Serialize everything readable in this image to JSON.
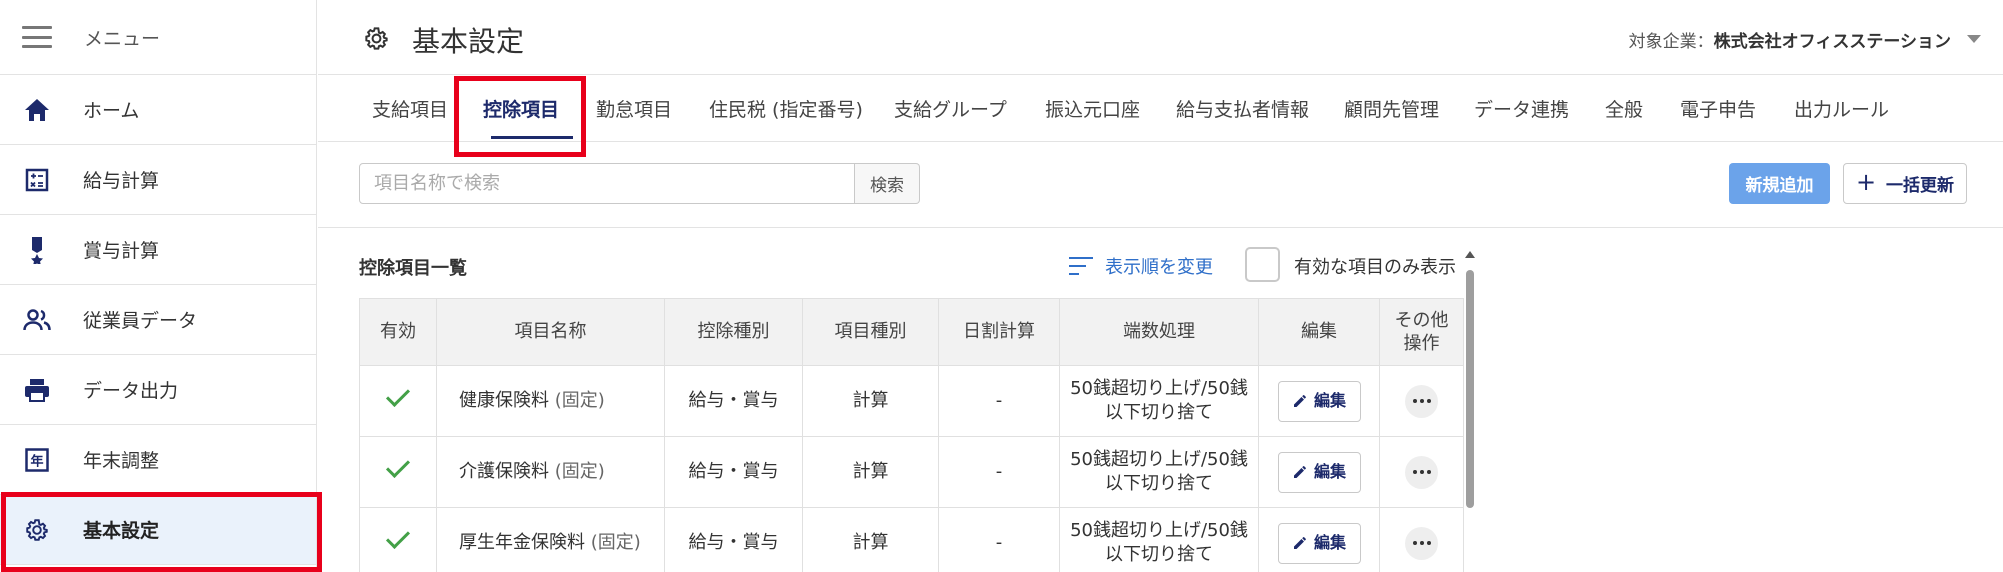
{
  "sidebar": {
    "menu_label": "メニュー",
    "items": [
      {
        "label": "ホーム",
        "icon": "home-icon"
      },
      {
        "label": "給与計算",
        "icon": "calculator-icon"
      },
      {
        "label": "賞与計算",
        "icon": "medal-icon"
      },
      {
        "label": "従業員データ",
        "icon": "people-icon"
      },
      {
        "label": "データ出力",
        "icon": "printer-icon"
      },
      {
        "label": "年末調整",
        "icon": "year-icon",
        "glyph": "年"
      },
      {
        "label": "基本設定",
        "icon": "gear-icon",
        "active": true
      }
    ]
  },
  "header": {
    "title": "基本設定",
    "company_prefix": "対象企業：",
    "company_name": "株式会社オフィスステーション"
  },
  "tabs": [
    {
      "label": "支給項目"
    },
    {
      "label": "控除項目",
      "active": true
    },
    {
      "label": "勤怠項目"
    },
    {
      "label": "住民税 (指定番号)"
    },
    {
      "label": "支給グループ"
    },
    {
      "label": "振込元口座"
    },
    {
      "label": "給与支払者情報"
    },
    {
      "label": "顧問先管理"
    },
    {
      "label": "データ連携"
    },
    {
      "label": "全般"
    },
    {
      "label": "電子申告"
    },
    {
      "label": "出力ルール"
    }
  ],
  "search": {
    "placeholder": "項目名称で検索",
    "button_label": "検索"
  },
  "actions": {
    "new_label": "新規追加",
    "bulk_label": "一括更新"
  },
  "list": {
    "title": "控除項目一覧",
    "sort_label": "表示順を変更",
    "filter_label": "有効な項目のみ表示",
    "columns": [
      "有効",
      "項目名称",
      "控除種別",
      "項目種別",
      "日割計算",
      "端数処理",
      "編集",
      "その他操作"
    ],
    "column_other_line1": "その他",
    "column_other_line2": "操作",
    "edit_label": "編集",
    "rows": [
      {
        "name": "健康保険料",
        "sub": "(固定)",
        "type": "給与・賞与",
        "kind": "計算",
        "daily": "-",
        "rounding_1": "50銭超切り上げ/50銭",
        "rounding_2": "以下切り捨て"
      },
      {
        "name": "介護保険料",
        "sub": "(固定)",
        "type": "給与・賞与",
        "kind": "計算",
        "daily": "-",
        "rounding_1": "50銭超切り上げ/50銭",
        "rounding_2": "以下切り捨て"
      },
      {
        "name": "厚生年金保険料",
        "sub": "(固定)",
        "type": "給与・賞与",
        "kind": "計算",
        "daily": "-",
        "rounding_1": "50銭超切り上げ/50銭",
        "rounding_2": "以下切り捨て"
      }
    ]
  },
  "colors": {
    "accent": "#1d2a6b",
    "primary_button": "#6ba3ea",
    "highlight_box": "#e8001b",
    "check_green": "#43a047",
    "active_sidebar_bg": "#eaf2fb"
  }
}
